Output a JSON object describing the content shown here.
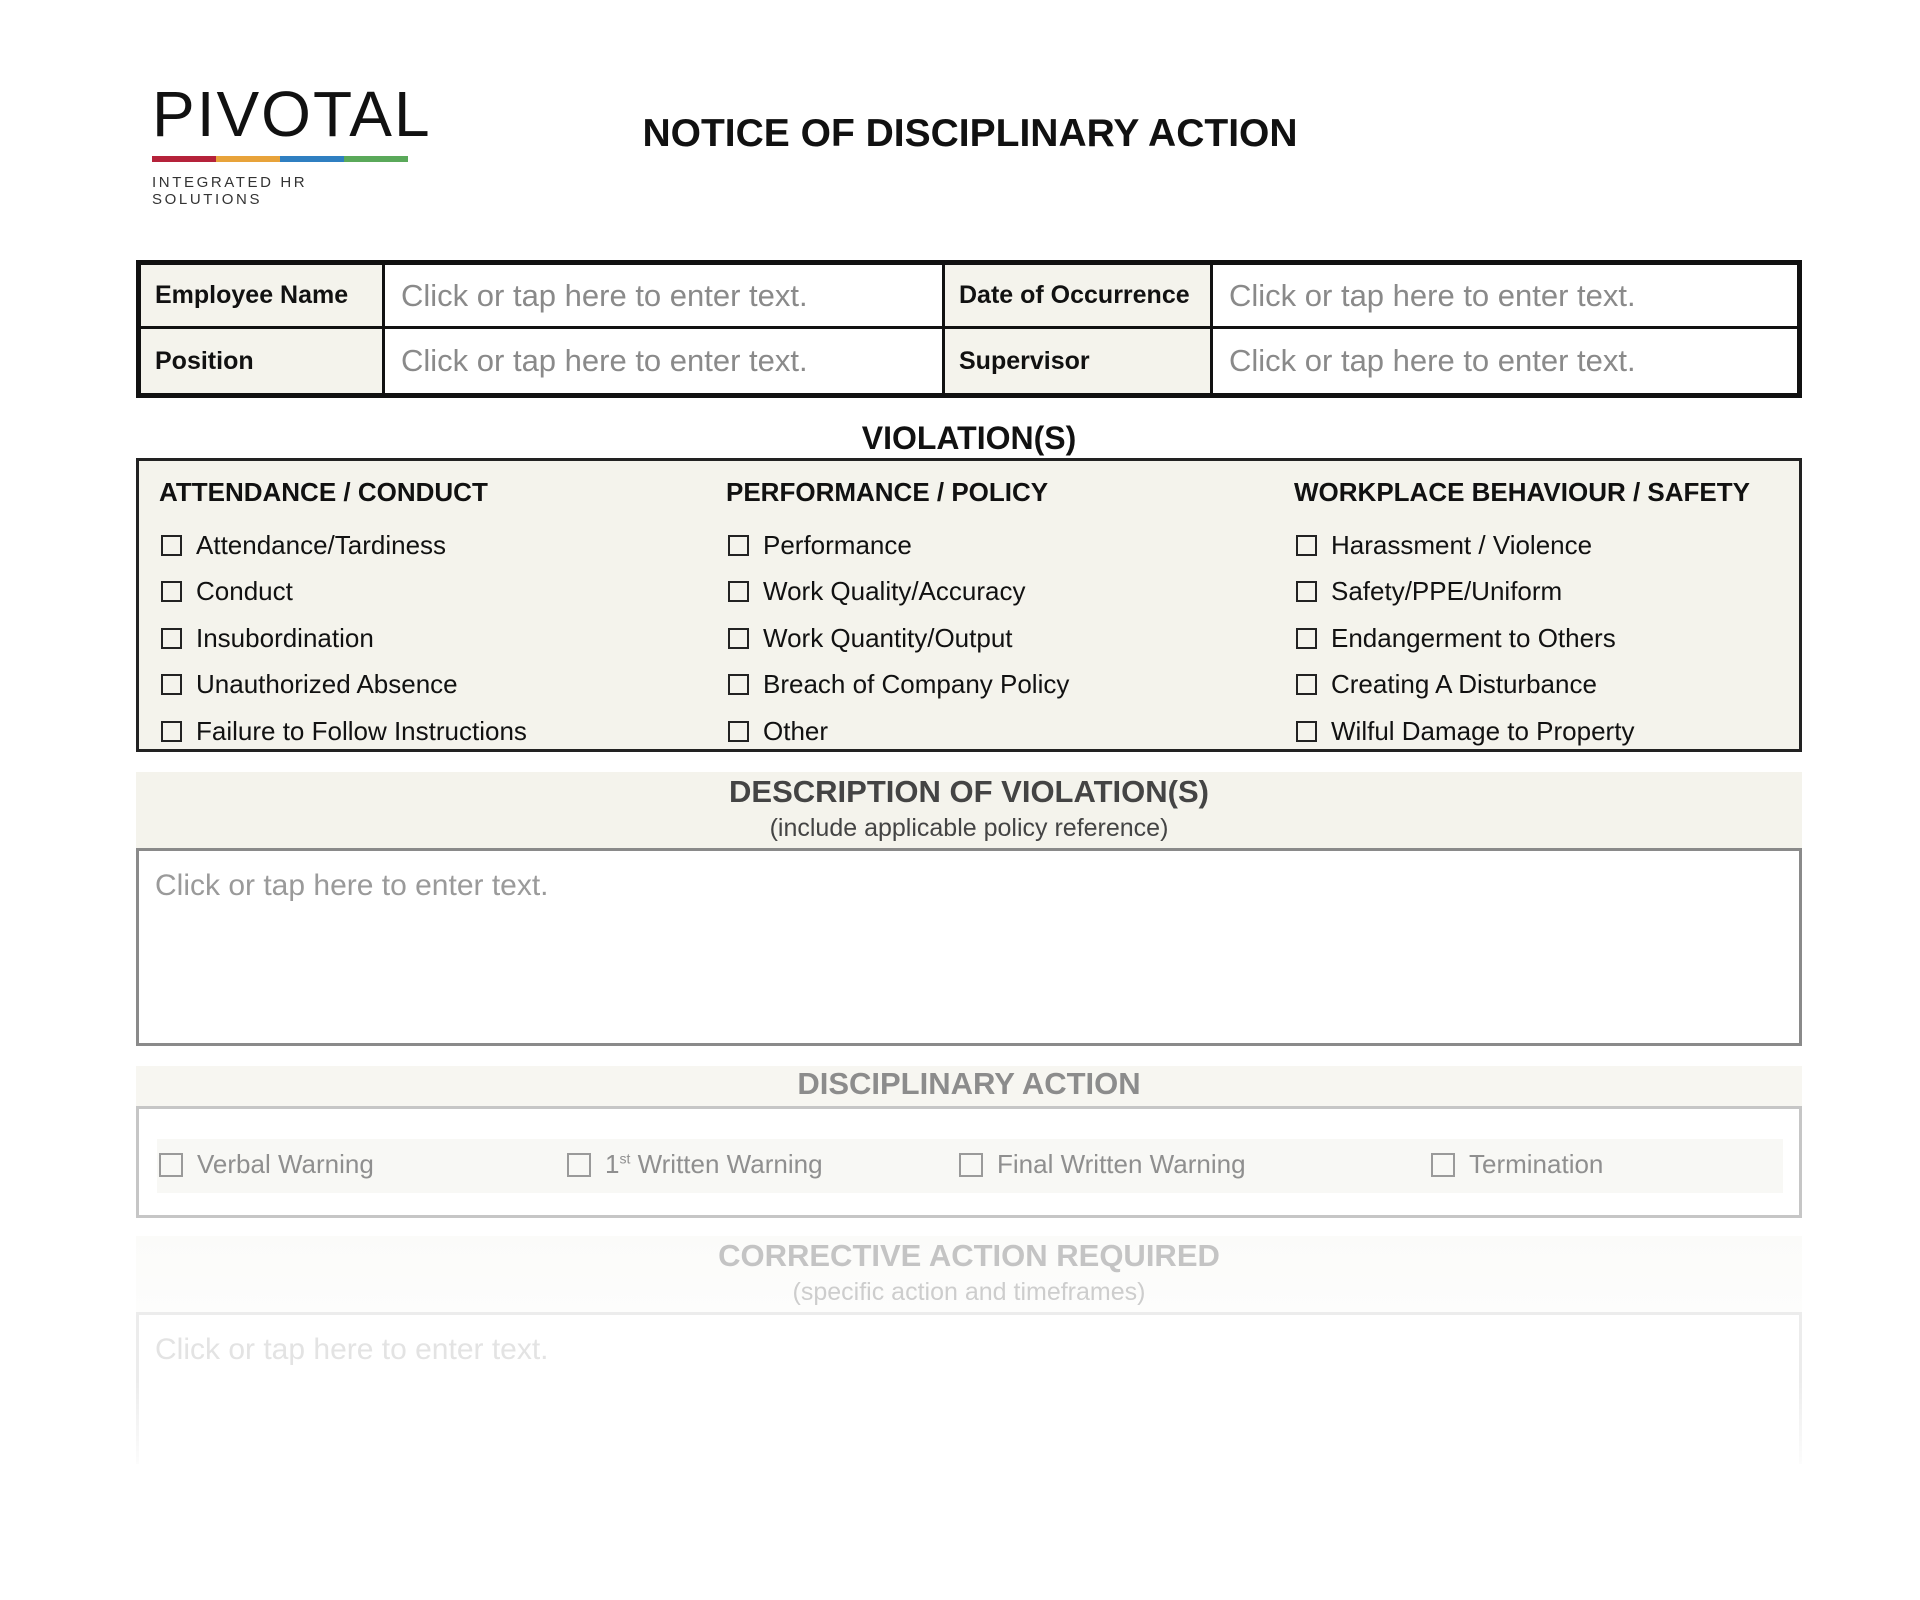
{
  "logo": {
    "wordmark": "PIVOTAL",
    "tagline": "INTEGRATED HR SOLUTIONS",
    "bar_colors": [
      "#b5223a",
      "#e8a33a",
      "#2f7fc1",
      "#5aa95a"
    ]
  },
  "title": "NOTICE OF DISCIPLINARY ACTION",
  "info": {
    "employee_name_label": "Employee Name",
    "employee_name_value": "Click or tap here to enter text.",
    "date_label": "Date of Occurrence",
    "date_value": "Click or tap here to enter text.",
    "position_label": "Position",
    "position_value": "Click or tap here to enter text.",
    "supervisor_label": "Supervisor",
    "supervisor_value": "Click or tap here to enter text."
  },
  "violations": {
    "title": "VIOLATION(S)",
    "columns": [
      {
        "heading": "ATTENDANCE / CONDUCT",
        "items": [
          "Attendance/Tardiness",
          "Conduct",
          "Insubordination",
          "Unauthorized Absence",
          "Failure to Follow Instructions"
        ]
      },
      {
        "heading": "PERFORMANCE / POLICY",
        "items": [
          "Performance",
          "Work Quality/Accuracy",
          "Work Quantity/Output",
          "Breach of Company Policy",
          "Other"
        ]
      },
      {
        "heading": "WORKPLACE BEHAVIOUR / SAFETY",
        "items": [
          "Harassment / Violence",
          "Safety/PPE/Uniform",
          "Endangerment to Others",
          "Creating A Disturbance",
          "Wilful Damage to Property"
        ]
      }
    ]
  },
  "description": {
    "title": "DESCRIPTION OF VIOLATION(S)",
    "subtitle": "(include applicable policy reference)",
    "placeholder": "Click or tap here to enter text."
  },
  "disciplinary": {
    "title": "DISCIPLINARY ACTION",
    "verbal": "Verbal Warning",
    "first_num": "1",
    "first_sup": "st",
    "first_rest": " Written Warning",
    "final": "Final Written Warning",
    "termination": "Termination"
  },
  "corrective": {
    "title": "CORRECTIVE ACTION REQUIRED",
    "subtitle": "(specific action and timeframes)",
    "placeholder": "Click or tap here to enter text."
  }
}
